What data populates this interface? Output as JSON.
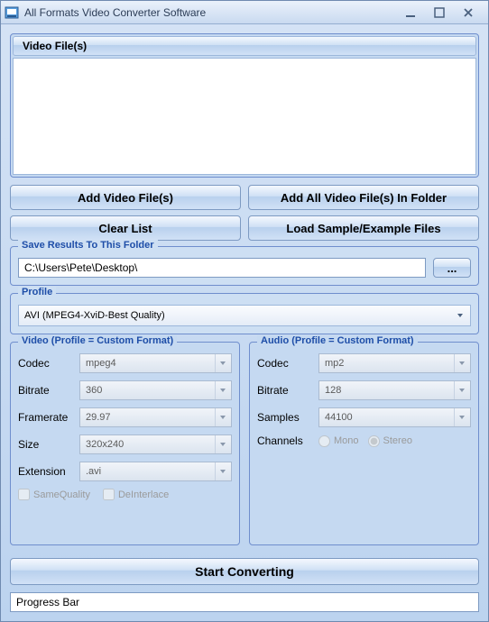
{
  "window": {
    "title": "All Formats Video Converter Software"
  },
  "filelist": {
    "header": "Video File(s)"
  },
  "buttons": {
    "add_files": "Add Video File(s)",
    "add_folder": "Add All Video File(s) In Folder",
    "clear": "Clear List",
    "load_sample": "Load Sample/Example Files",
    "browse": "...",
    "start": "Start Converting"
  },
  "save": {
    "legend": "Save Results To This Folder",
    "path": "C:\\Users\\Pete\\Desktop\\"
  },
  "profile": {
    "legend": "Profile",
    "value": "AVI (MPEG4-XviD-Best Quality)"
  },
  "video": {
    "legend": "Video (Profile = Custom Format)",
    "codec_label": "Codec",
    "codec": "mpeg4",
    "bitrate_label": "Bitrate",
    "bitrate": "360",
    "framerate_label": "Framerate",
    "framerate": "29.97",
    "size_label": "Size",
    "size": "320x240",
    "ext_label": "Extension",
    "ext": ".avi",
    "samequality": "SameQuality",
    "deinterlace": "DeInterlace"
  },
  "audio": {
    "legend": "Audio (Profile = Custom Format)",
    "codec_label": "Codec",
    "codec": "mp2",
    "bitrate_label": "Bitrate",
    "bitrate": "128",
    "samples_label": "Samples",
    "samples": "44100",
    "channels_label": "Channels",
    "mono": "Mono",
    "stereo": "Stereo"
  },
  "progress": {
    "label": "Progress Bar"
  }
}
